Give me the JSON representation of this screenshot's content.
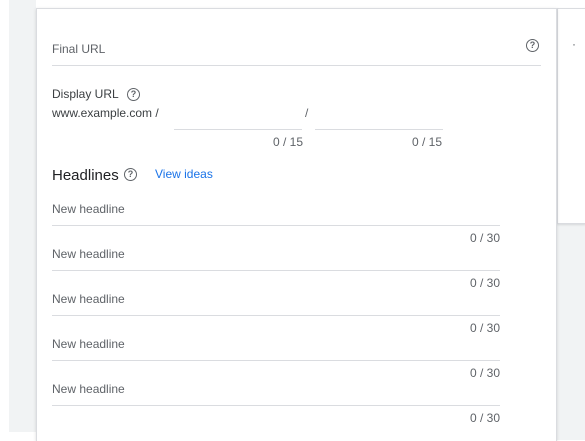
{
  "final_url": {
    "placeholder": "Final URL"
  },
  "display_url": {
    "label": "Display URL",
    "base": "www.example.com /",
    "separator": "/",
    "path1_counter": "0 / 15",
    "path2_counter": "0 / 15"
  },
  "headlines": {
    "title": "Headlines",
    "view_ideas": "View ideas",
    "items": [
      {
        "placeholder": "New headline",
        "counter": "0 / 30"
      },
      {
        "placeholder": "New headline",
        "counter": "0 / 30"
      },
      {
        "placeholder": "New headline",
        "counter": "0 / 30"
      },
      {
        "placeholder": "New headline",
        "counter": "0 / 30"
      },
      {
        "placeholder": "New headline",
        "counter": "0 / 30"
      }
    ]
  },
  "icons": {
    "help": "help-circle-icon"
  },
  "colors": {
    "link": "#1a73e8",
    "muted": "#5f6368",
    "divider": "#dadce0",
    "background": "#f1f3f4"
  }
}
